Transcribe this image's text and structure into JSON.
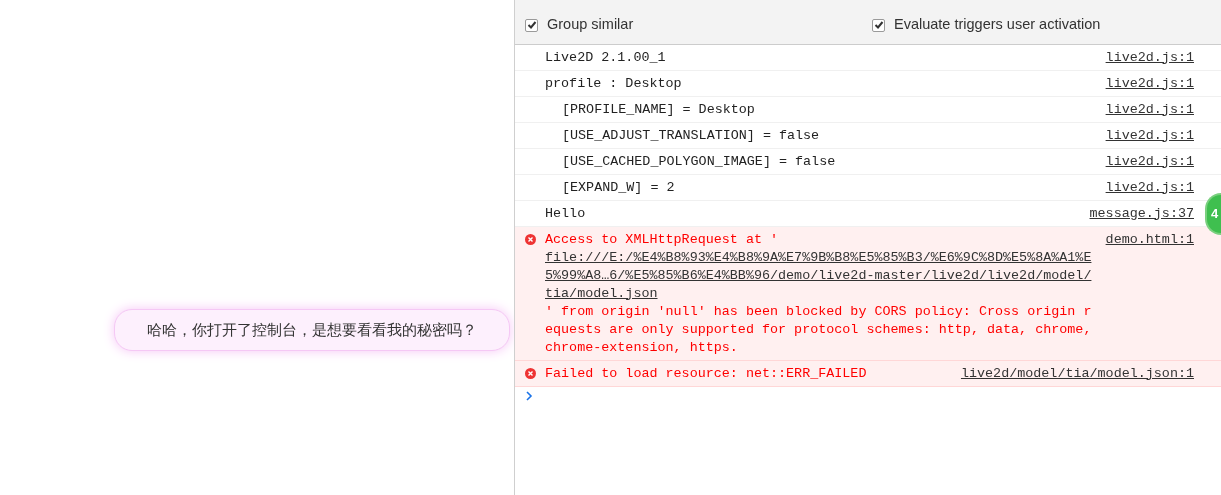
{
  "speech_bubble": {
    "text": "哈哈，你打开了控制台，是想要看看我的秘密吗？"
  },
  "console_settings": [
    {
      "label": "Group similar",
      "checked": true
    },
    {
      "label": "Evaluate triggers user activation",
      "checked": true
    }
  ],
  "console_messages": [
    {
      "kind": "log",
      "text": "Live2D 2.1.00_1",
      "source": "live2d.js:1"
    },
    {
      "kind": "log",
      "text": "profile : Desktop",
      "source": "live2d.js:1",
      "children": [
        {
          "kind": "log",
          "text": "[PROFILE_NAME] = Desktop",
          "source": "live2d.js:1"
        },
        {
          "kind": "log",
          "text": "[USE_ADJUST_TRANSLATION] = false",
          "source": "live2d.js:1"
        },
        {
          "kind": "log",
          "text": "[USE_CACHED_POLYGON_IMAGE] = false",
          "source": "live2d.js:1"
        },
        {
          "kind": "log",
          "text": "[EXPAND_W] = 2",
          "source": "live2d.js:1"
        }
      ]
    },
    {
      "kind": "log",
      "text": "Hello",
      "source": "message.js:37"
    },
    {
      "kind": "error",
      "text": "Access to XMLHttpRequest at '",
      "link": "file:///E:/%E4%B8%93%E4%B8%9A%E7%9B%B8%E5%85%B3/%E6%9C%8D%E5%8A%A1%E5%99%A8…6/%E5%85%B6%E4%BB%96/demo/live2d-master/live2d/live2d/model/tia/model.json",
      "text_after": "' from origin 'null' has been blocked by CORS policy: Cross origin requests are only supported for protocol schemes: http, data, chrome, chrome-extension, https.",
      "source": "demo.html:1"
    },
    {
      "kind": "error",
      "text": "Failed to load resource: net::ERR_FAILED",
      "source": "live2d/model/tia/model.json:1"
    }
  ],
  "side_badge": {
    "text": "4"
  }
}
